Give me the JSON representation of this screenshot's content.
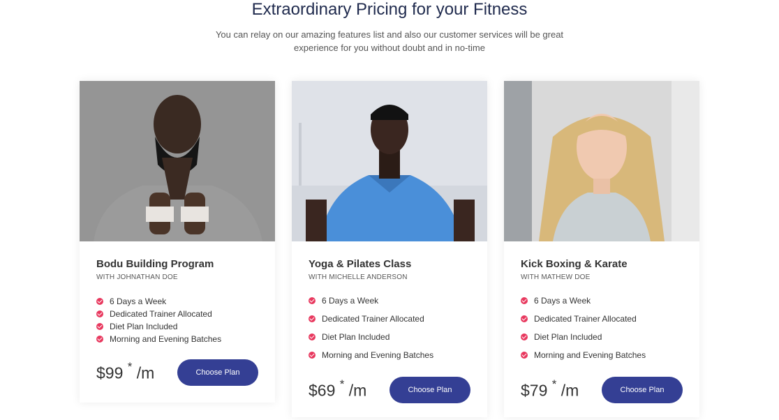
{
  "header": {
    "title": "Extraordinary Pricing for your Fitness",
    "subtitle": "You can relay on our amazing features list and also our customer services will be great experience for you without doubt and in no-time"
  },
  "plans": [
    {
      "name": "Bodu Building Program",
      "trainer": "WITH JOHNATHAN DOE",
      "features": [
        "6 Days a Week",
        "Dedicated Trainer Allocated",
        "Diet Plan Included",
        "Morning and Evening Batches"
      ],
      "price": "$99",
      "asterisk": "*",
      "period": "/m",
      "button": "Choose Plan"
    },
    {
      "name": "Yoga & Pilates Class",
      "trainer": "WITH MICHELLE ANDERSON",
      "features": [
        "6 Days a Week",
        "Dedicated Trainer Allocated",
        "Diet Plan Included",
        "Morning and Evening Batches"
      ],
      "price": "$69",
      "asterisk": "*",
      "period": "/m",
      "button": "Choose Plan"
    },
    {
      "name": "Kick Boxing & Karate",
      "trainer": "WITH MATHEW DOE",
      "features": [
        "6 Days a Week",
        "Dedicated Trainer Allocated",
        "Diet Plan Included",
        "Morning and Evening Batches"
      ],
      "price": "$79",
      "asterisk": "*",
      "period": "/m",
      "button": "Choose Plan"
    }
  ],
  "colors": {
    "accent": "#343f94",
    "check": "#e8385e",
    "title": "#1f2a4d"
  }
}
